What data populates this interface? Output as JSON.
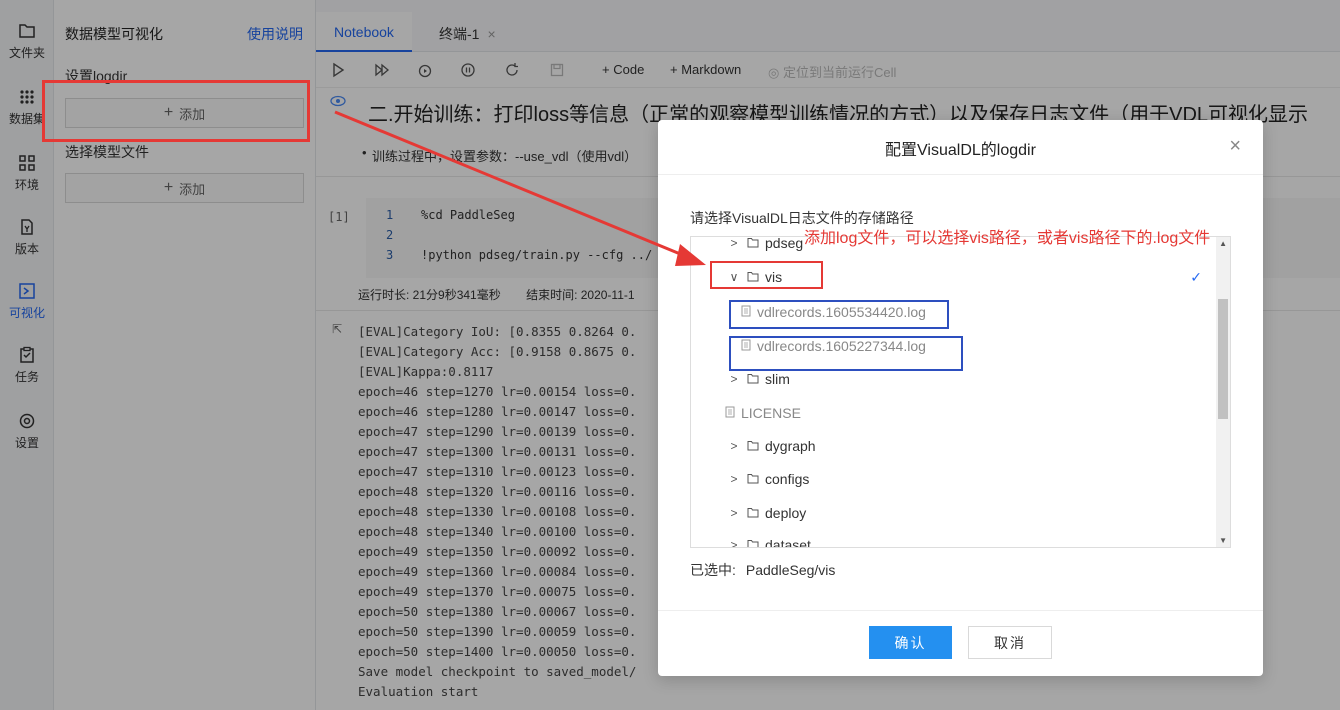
{
  "rail": {
    "items": [
      {
        "label": "文件夹"
      },
      {
        "label": "数据集"
      },
      {
        "label": "环境"
      },
      {
        "label": "版本"
      },
      {
        "label": "可视化"
      },
      {
        "label": "任务"
      },
      {
        "label": "设置"
      }
    ]
  },
  "side": {
    "title": "数据模型可视化",
    "help": "使用说明",
    "logdir_label": "设置logdir",
    "add_label": "添加",
    "model_label": "选择模型文件",
    "add_label_2": "添加"
  },
  "tabs": [
    {
      "label": "Notebook"
    },
    {
      "label": "终端-1"
    }
  ],
  "toolbar": {
    "code_label": "Code",
    "markdown_label": "Markdown",
    "locate_label": "定位到当前运行Cell"
  },
  "notebook": {
    "heading": "二.开始训练：打印loss等信息（正常的观察模型训练情况的方式）以及保存日志文件（用于VDL可视化显示",
    "bullet": "训练过程中，设置参数：--use_vdl（使用vdl）",
    "cell_number": "[1]",
    "line_numbers": [
      "1",
      "2",
      "3"
    ],
    "code_lines": [
      "%cd PaddleSeg",
      "",
      "!python pdseg/train.py --cfg ../"
    ],
    "runtime": "运行时长: 21分9秒341毫秒",
    "endtime": "结束时间: 2020-11-1",
    "output": [
      "[EVAL]Category IoU: [0.8355 0.8264 0.",
      "[EVAL]Category Acc: [0.9158 0.8675 0.",
      "[EVAL]Kappa:0.8117",
      "epoch=46 step=1270 lr=0.00154 loss=0.",
      "epoch=46 step=1280 lr=0.00147 loss=0.",
      "epoch=47 step=1290 lr=0.00139 loss=0.",
      "epoch=47 step=1300 lr=0.00131 loss=0.",
      "epoch=47 step=1310 lr=0.00123 loss=0.",
      "epoch=48 step=1320 lr=0.00116 loss=0.",
      "epoch=48 step=1330 lr=0.00108 loss=0.",
      "epoch=48 step=1340 lr=0.00100 loss=0.",
      "epoch=49 step=1350 lr=0.00092 loss=0.",
      "epoch=49 step=1360 lr=0.00084 loss=0.",
      "epoch=49 step=1370 lr=0.00075 loss=0.",
      "epoch=50 step=1380 lr=0.00067 loss=0.",
      "epoch=50 step=1390 lr=0.00059 loss=0.",
      "epoch=50 step=1400 lr=0.00050 loss=0.",
      "Save model checkpoint to saved_model/",
      "Evaluation start"
    ]
  },
  "modal": {
    "title": "配置VisualDL的logdir",
    "prompt": "请选择VisualDL日志文件的存储路径",
    "tree": [
      {
        "name": "pdseg",
        "kind": "folder",
        "state": "collapsed"
      },
      {
        "name": "vis",
        "kind": "folder",
        "state": "expanded",
        "selected": true
      },
      {
        "name": "vdlrecords.1605534420.log",
        "kind": "file"
      },
      {
        "name": "vdlrecords.1605227344.log",
        "kind": "file"
      },
      {
        "name": "slim",
        "kind": "folder",
        "state": "collapsed"
      },
      {
        "name": "LICENSE",
        "kind": "file"
      },
      {
        "name": "dygraph",
        "kind": "folder",
        "state": "collapsed"
      },
      {
        "name": "configs",
        "kind": "folder",
        "state": "collapsed"
      },
      {
        "name": "deploy",
        "kind": "folder",
        "state": "collapsed"
      },
      {
        "name": "dataset",
        "kind": "folder",
        "state": "collapsed"
      }
    ],
    "selected_label": "已选中:",
    "selected_value": "PaddleSeg/vis",
    "ok_label": "确认",
    "cancel_label": "取消"
  },
  "annotation": {
    "text": "添加log文件，可以选择vis路径，或者vis路径下的.log文件",
    "color": "#e53935",
    "box_color_blue": "#2d4fbf"
  },
  "colors": {
    "accent": "#2468f2",
    "ok_button": "#2490f0"
  }
}
